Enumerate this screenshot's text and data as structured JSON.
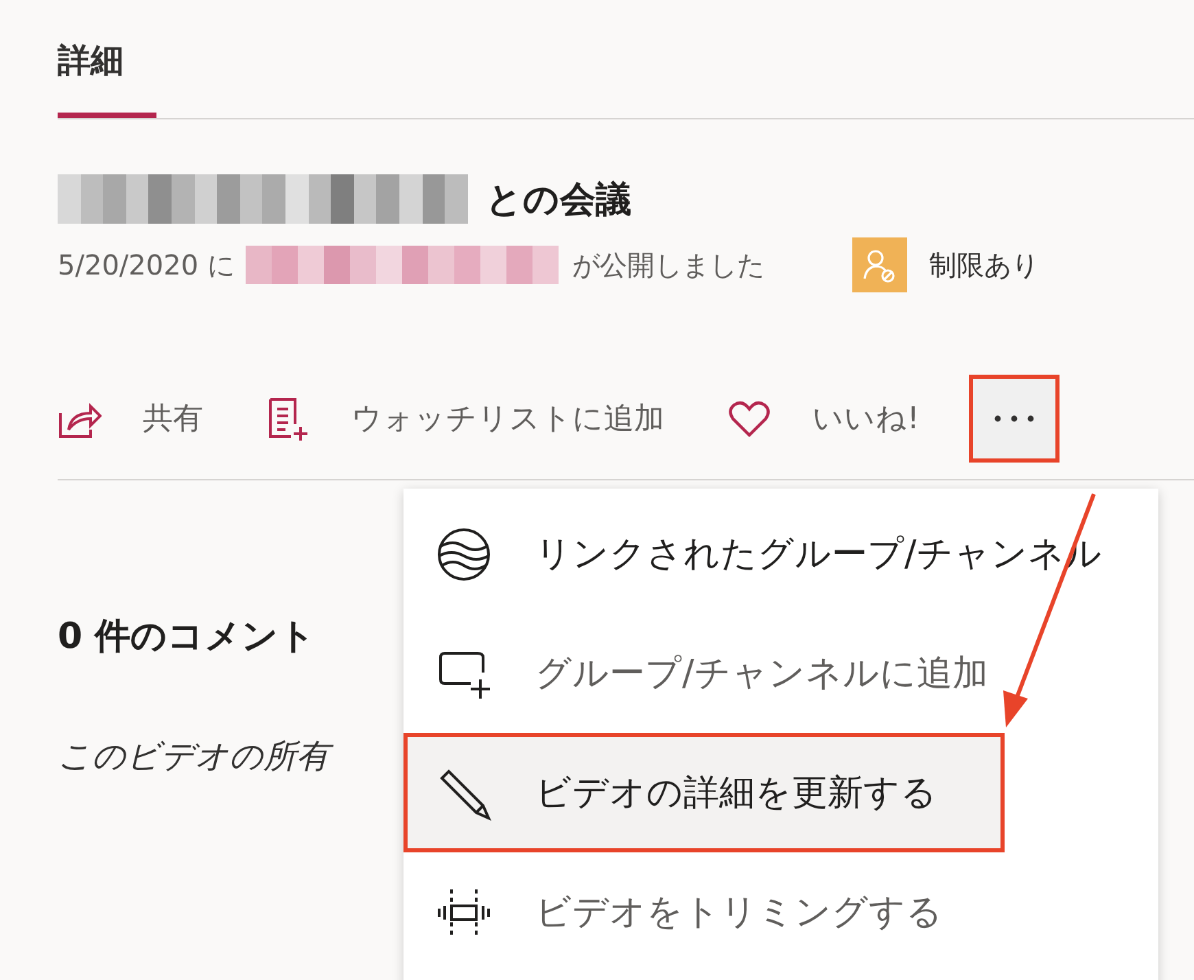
{
  "tabs": [
    {
      "label": "詳細",
      "selected": true
    }
  ],
  "video": {
    "title_owner_redacted": true,
    "title": "との会議",
    "date": "5/20/2020 に",
    "publisher_redacted": true,
    "published": "が公開しました",
    "restriction": "制限あり"
  },
  "actions": [
    {
      "kind": "share",
      "label": "共有"
    },
    {
      "kind": "watchlist",
      "label": "ウォッチリストに追加"
    },
    {
      "kind": "like",
      "label": "いいね!"
    }
  ],
  "more_button": {
    "annotated": true
  },
  "comments": {
    "heading": "0 件のコメント",
    "notice": "このビデオの所有"
  },
  "menu": {
    "items": [
      {
        "kind": "globe",
        "label": "リンクされたグループ/チャンネル",
        "disabled": false,
        "selected": false,
        "annotated": false
      },
      {
        "kind": "add",
        "label": "グループ/チャンネルに追加",
        "disabled": true,
        "selected": false,
        "annotated": false
      },
      {
        "kind": "edit",
        "label": "ビデオの詳細を更新する",
        "disabled": false,
        "selected": true,
        "annotated": true
      },
      {
        "kind": "trim",
        "label": "ビデオをトリミングする",
        "disabled": true,
        "selected": false,
        "annotated": false
      }
    ]
  },
  "annotation_arrow": true
}
